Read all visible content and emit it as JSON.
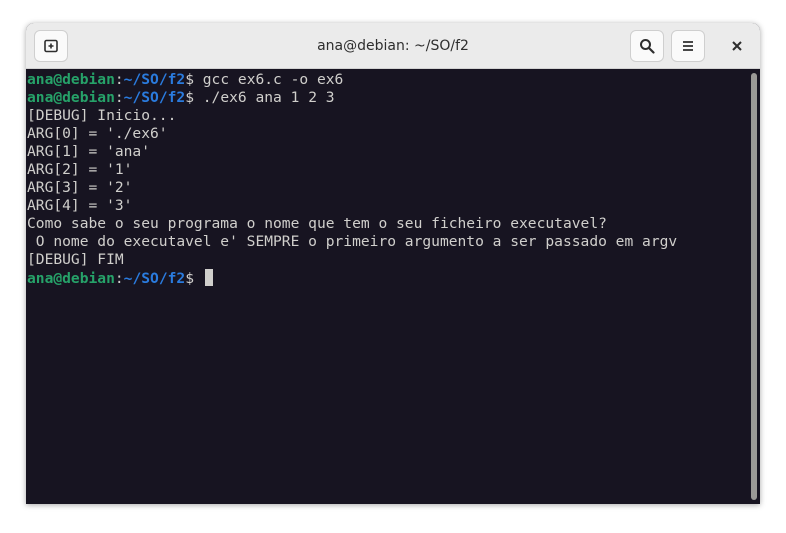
{
  "window": {
    "title": "ana@debian: ~/SO/f2"
  },
  "titlebar": {
    "new_tab_icon": "new-tab-icon",
    "search_icon": "search-icon",
    "menu_icon": "hamburger-menu-icon",
    "close_icon": "close-icon"
  },
  "terminal": {
    "lines": [
      {
        "prompt": {
          "user": "ana@debian",
          "sep": ":",
          "path": "~/SO/f2",
          "symbol": "$ "
        },
        "text": "gcc ex6.c -o ex6"
      },
      {
        "prompt": {
          "user": "ana@debian",
          "sep": ":",
          "path": "~/SO/f2",
          "symbol": "$ "
        },
        "text": "./ex6 ana 1 2 3"
      },
      {
        "text": "[DEBUG] Inicio..."
      },
      {
        "text": "ARG[0] = './ex6'"
      },
      {
        "text": "ARG[1] = 'ana'"
      },
      {
        "text": "ARG[2] = '1'"
      },
      {
        "text": "ARG[3] = '2'"
      },
      {
        "text": "ARG[4] = '3'"
      },
      {
        "text": "Como sabe o seu programa o nome que tem o seu ficheiro executavel?"
      },
      {
        "text": " O nome do executavel e' SEMPRE o primeiro argumento a ser passado em argv"
      },
      {
        "text": "[DEBUG] FIM"
      },
      {
        "prompt": {
          "user": "ana@debian",
          "sep": ":",
          "path": "~/SO/f2",
          "symbol": "$ "
        },
        "text": "",
        "cursor": true
      }
    ]
  },
  "colors": {
    "terminal_bg": "#171421",
    "terminal_fg": "#d0cfcc",
    "prompt_user": "#26a269",
    "prompt_path": "#2a7bde",
    "titlebar_bg": "#ebebeb"
  }
}
